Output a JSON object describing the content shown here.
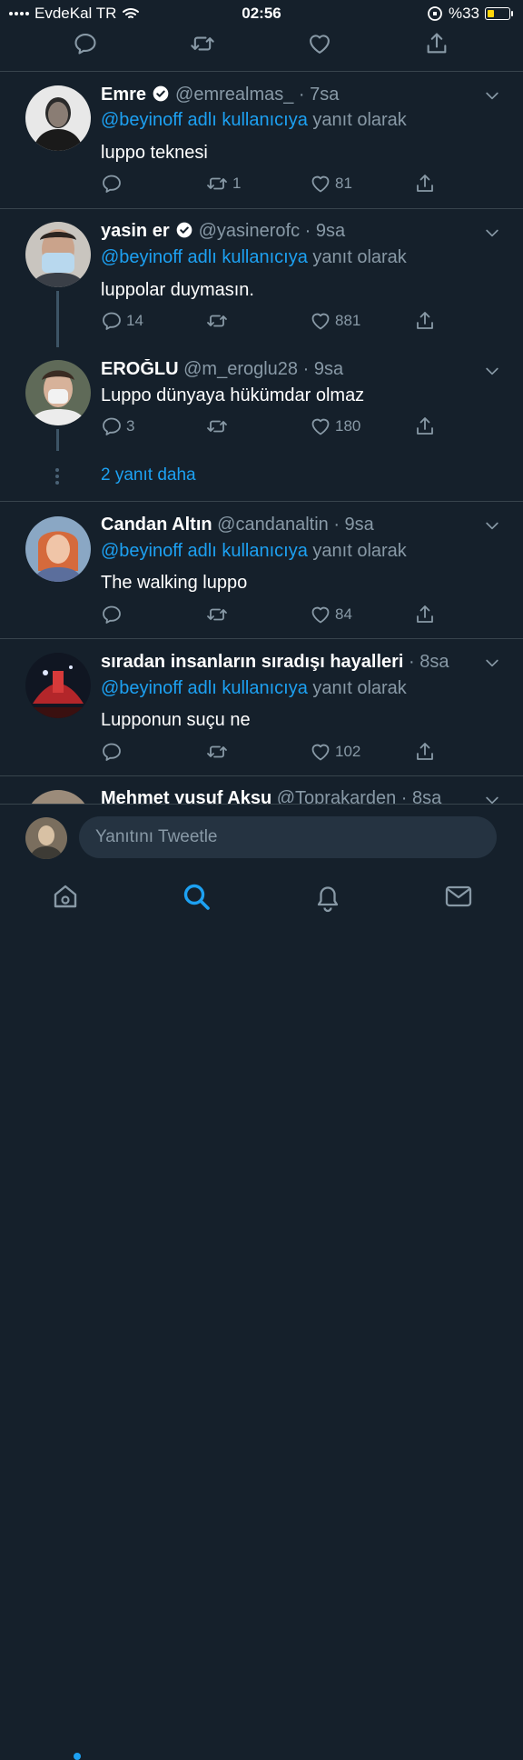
{
  "status_bar": {
    "carrier": "EvdeKal TR",
    "time": "02:56",
    "battery": "%33",
    "battery_level": 0.33
  },
  "tweets": [
    {
      "name": "Emre",
      "verified": true,
      "handle": "@emrealmas_",
      "time": "7sa",
      "reply_mention": "@beyinoff adlı kullanıcıya",
      "reply_suffix": "yanıt olarak",
      "text": "luppo teknesi",
      "replies": "",
      "retweets": "1",
      "likes": "81"
    },
    {
      "name": "yasin er",
      "verified": true,
      "handle": "@yasinerofc",
      "time": "9sa",
      "reply_mention": "@beyinoff adlı kullanıcıya",
      "reply_suffix": "yanıt olarak",
      "text": "luppolar duymasın.",
      "replies": "14",
      "retweets": "",
      "likes": "881"
    },
    {
      "name": "EROĞLU",
      "verified": false,
      "handle": "@m_eroglu28",
      "time": "9sa",
      "text": "Luppo dünyaya hükümdar olmaz",
      "replies": "3",
      "retweets": "",
      "likes": "180"
    },
    {
      "name": "Candan Altın",
      "verified": false,
      "handle": "@candanaltin",
      "time": "9sa",
      "reply_mention": "@beyinoff adlı kullanıcıya",
      "reply_suffix": "yanıt olarak",
      "text": "The walking luppo",
      "replies": "",
      "retweets": "",
      "likes": "84"
    },
    {
      "name": "sıradan insanların sıradışı hayalleri",
      "verified": false,
      "handle": "",
      "time": "8sa",
      "reply_mention": "@beyinoff adlı kullanıcıya",
      "reply_suffix": "yanıt olarak",
      "text": "Lupponun suçu ne",
      "replies": "",
      "retweets": "",
      "likes": "102"
    },
    {
      "name": "Mehmet yusuf Aksu",
      "verified": false,
      "handle": "@Toprakarden",
      "time": "8sa"
    }
  ],
  "more_replies": "2 yanıt daha",
  "composer": {
    "placeholder": "Yanıtını Tweetle"
  },
  "tabs": [
    {
      "icon": "home-icon",
      "has_notification": true
    },
    {
      "icon": "search-icon",
      "active": true
    },
    {
      "icon": "bell-icon"
    },
    {
      "icon": "mail-icon"
    }
  ],
  "colors": {
    "background": "#15202b",
    "accent": "#1da1f2",
    "muted": "#8899a6",
    "divider": "#38444d"
  }
}
